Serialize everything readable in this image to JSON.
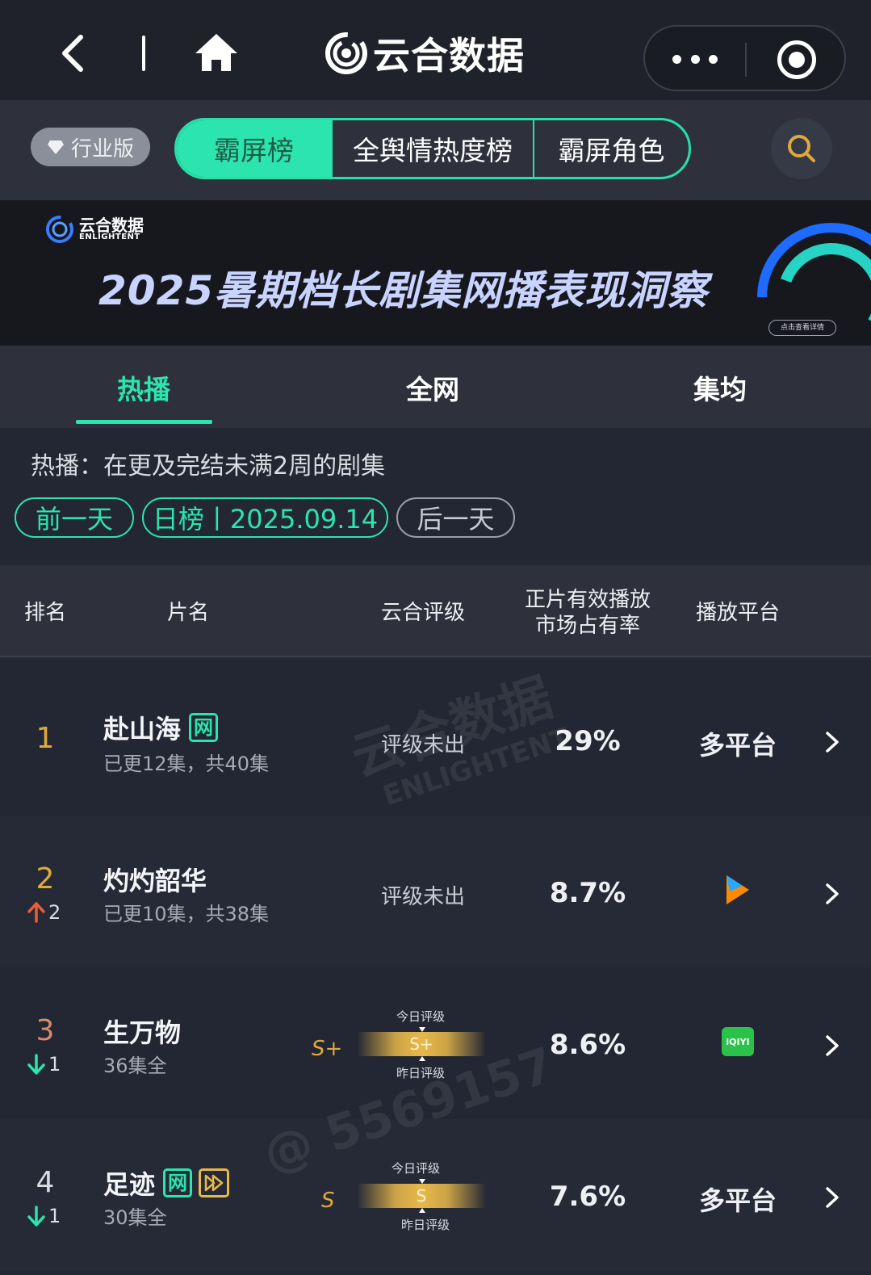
{
  "app": {
    "title": "云合数据"
  },
  "nav": {
    "edition": "行业版",
    "tabs": [
      {
        "label": "霸屏榜",
        "active": true
      },
      {
        "label": "全舆情热度榜",
        "active": false
      },
      {
        "label": "霸屏角色",
        "active": false
      }
    ]
  },
  "banner": {
    "logo_cn": "云合数据",
    "logo_en": "ENLIGHTENT",
    "title": "2025暑期档长剧集网播表现洞察",
    "cta": "点击查看详情"
  },
  "subtabs": [
    {
      "label": "热播",
      "active": true
    },
    {
      "label": "全网",
      "active": false
    },
    {
      "label": "集均",
      "active": false
    }
  ],
  "filter": {
    "description": "热播：在更及完结未满2周的剧集",
    "prev_label": "前一天",
    "current_label": "日榜丨2025.09.14",
    "next_label": "后一天"
  },
  "table": {
    "headers": {
      "rank": "排名",
      "title": "片名",
      "grade": "云合评级",
      "share_line1": "正片有效播放",
      "share_line2": "市场占有率",
      "platform": "播放平台"
    },
    "rows": [
      {
        "rank": "1",
        "change": "",
        "change_dir": "none",
        "title": "赴山海",
        "badges": [
          "网"
        ],
        "episodes": "已更12集，共40集",
        "grade_text": "评级未出",
        "share": "29%",
        "platform": "多平台",
        "platform_icon": ""
      },
      {
        "rank": "2",
        "change": "2",
        "change_dir": "up",
        "title": "灼灼韶华",
        "badges": [],
        "episodes": "已更10集，共38集",
        "grade_text": "评级未出",
        "share": "8.7%",
        "platform": "",
        "platform_icon": "tencent-video-icon"
      },
      {
        "rank": "3",
        "change": "1",
        "change_dir": "down",
        "title": "生万物",
        "badges": [],
        "episodes": "36集全",
        "grade": "S+",
        "grade_today_label": "今日评级",
        "grade_yesterday_label": "昨日评级",
        "grade_bar_value": "S+",
        "share": "8.6%",
        "platform": "",
        "platform_icon": "iqiyi-icon",
        "platform_icon_text": "iQIYI"
      },
      {
        "rank": "4",
        "change": "1",
        "change_dir": "down",
        "title": "足迹",
        "badges": [
          "网",
          "play"
        ],
        "episodes": "30集全",
        "grade": "S",
        "grade_today_label": "今日评级",
        "grade_yesterday_label": "昨日评级",
        "grade_bar_value": "S",
        "share": "7.6%",
        "platform": "多平台",
        "platform_icon": ""
      }
    ]
  },
  "watermark": {
    "brand": "云合数据",
    "brand_en": "ENLIGHTENT",
    "id": "@ 5569157"
  },
  "colors": {
    "accent": "#2ce5ae",
    "rank_gold": "#e0a93a",
    "rank_copper": "#d98a6a",
    "up": "#e8603a",
    "down": "#2ce5ae",
    "bg": "#232733"
  }
}
